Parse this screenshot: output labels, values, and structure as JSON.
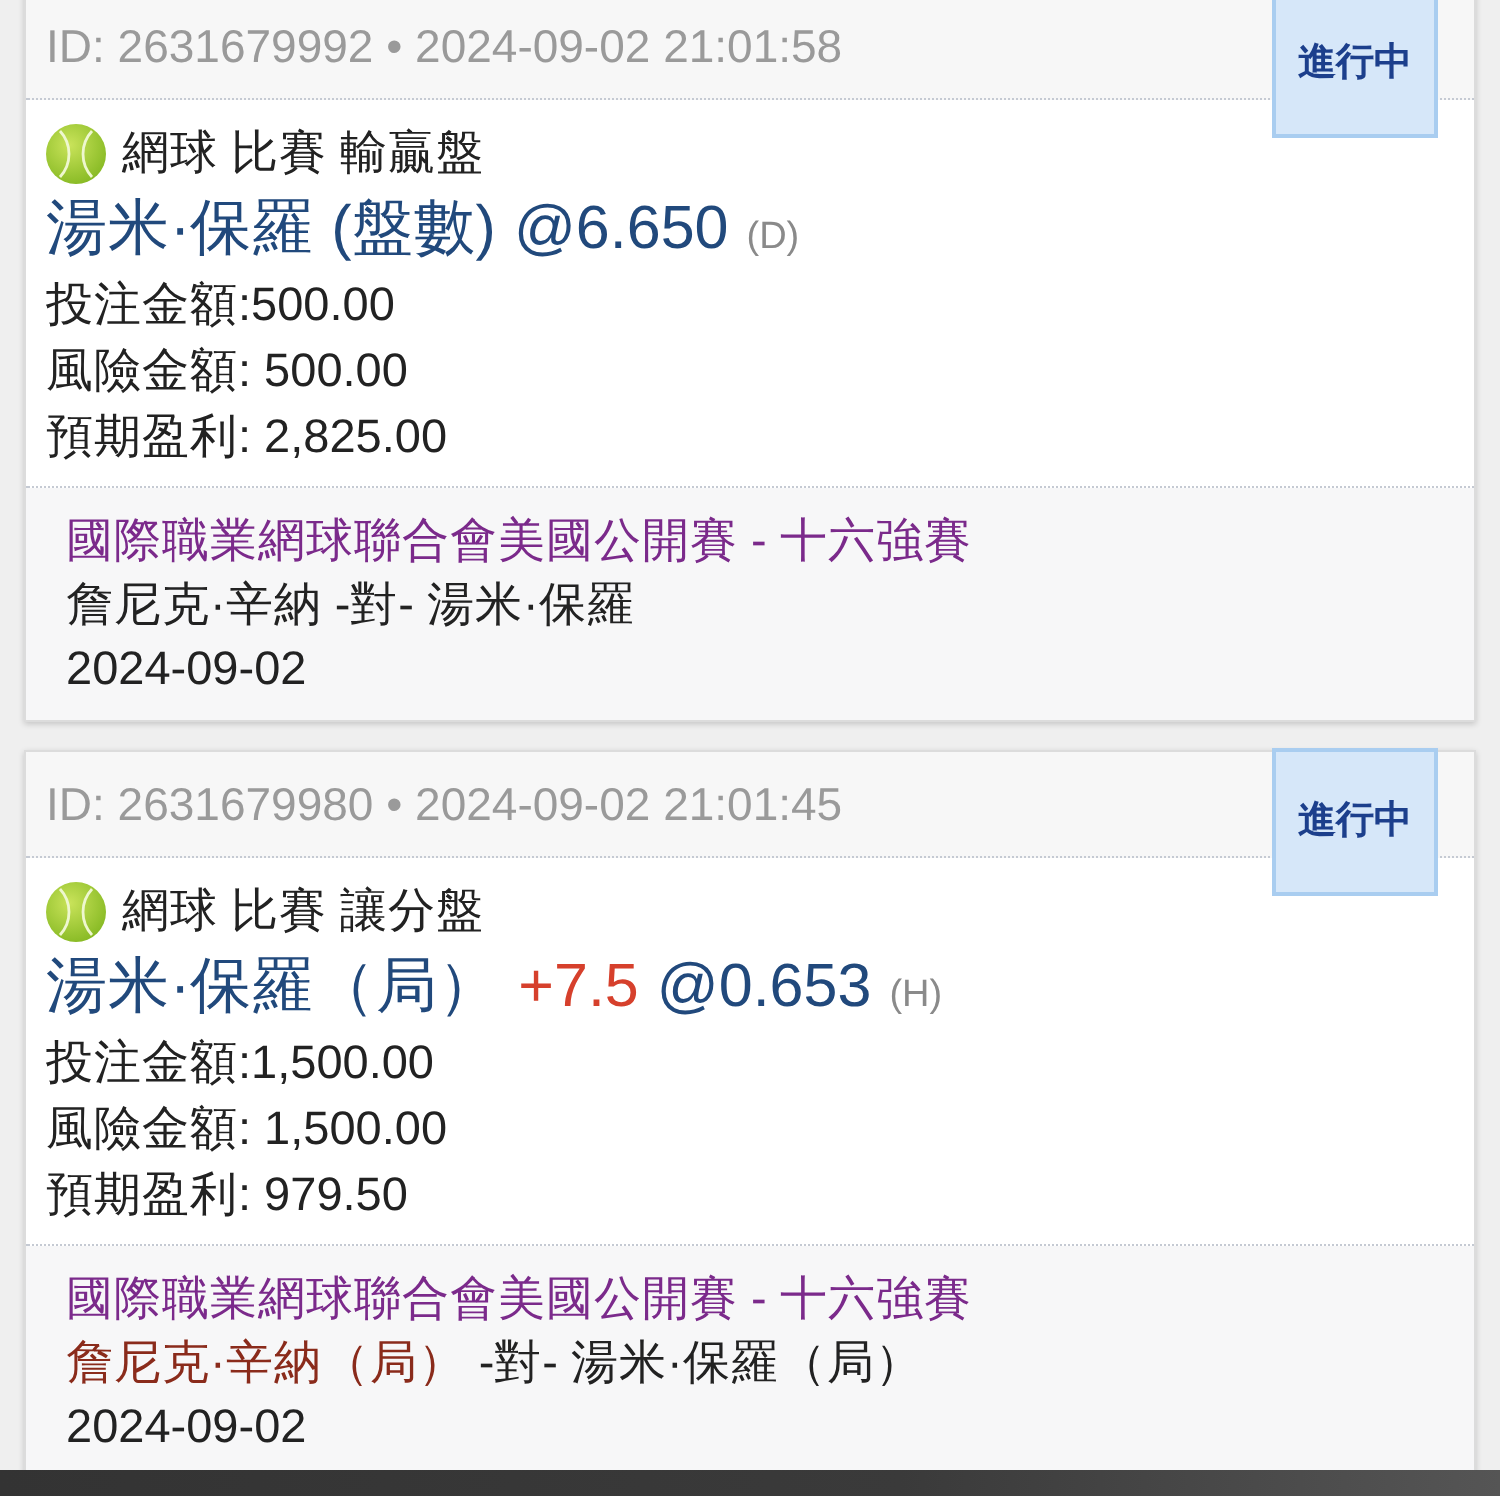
{
  "bets": [
    {
      "header": "ID: 2631679992 • 2024-09-02 21:01:58",
      "status": "進行中",
      "market": "網球 比賽 輸贏盤",
      "selection": "湯米·保羅 (盤數)",
      "odds": "@6.650",
      "odds_type": "(D)",
      "amounts": [
        "投注金額:500.00",
        "風險金額: 500.00",
        "預期盈利: 2,825.00"
      ],
      "league": "國際職業網球聯合會美國公開賽 - 十六強賽",
      "home": "詹尼克·辛納",
      "home_highlighted": false,
      "versus": "-對-",
      "away": "湯米·保羅",
      "date": "2024-09-02"
    },
    {
      "header": "ID: 2631679980 • 2024-09-02 21:01:45",
      "status": "進行中",
      "market": "網球 比賽 讓分盤",
      "selection": "湯米·保羅（局）",
      "handicap": "+7.5",
      "odds": "@0.653",
      "odds_type": "(H)",
      "amounts": [
        "投注金額:1,500.00",
        "風險金額: 1,500.00",
        "預期盈利: 979.50"
      ],
      "league": "國際職業網球聯合會美國公開賽 - 十六強賽",
      "home": "詹尼克·辛納（局）",
      "home_highlighted": true,
      "versus": "-對-",
      "away": "湯米·保羅（局）",
      "date": "2024-09-02"
    }
  ]
}
